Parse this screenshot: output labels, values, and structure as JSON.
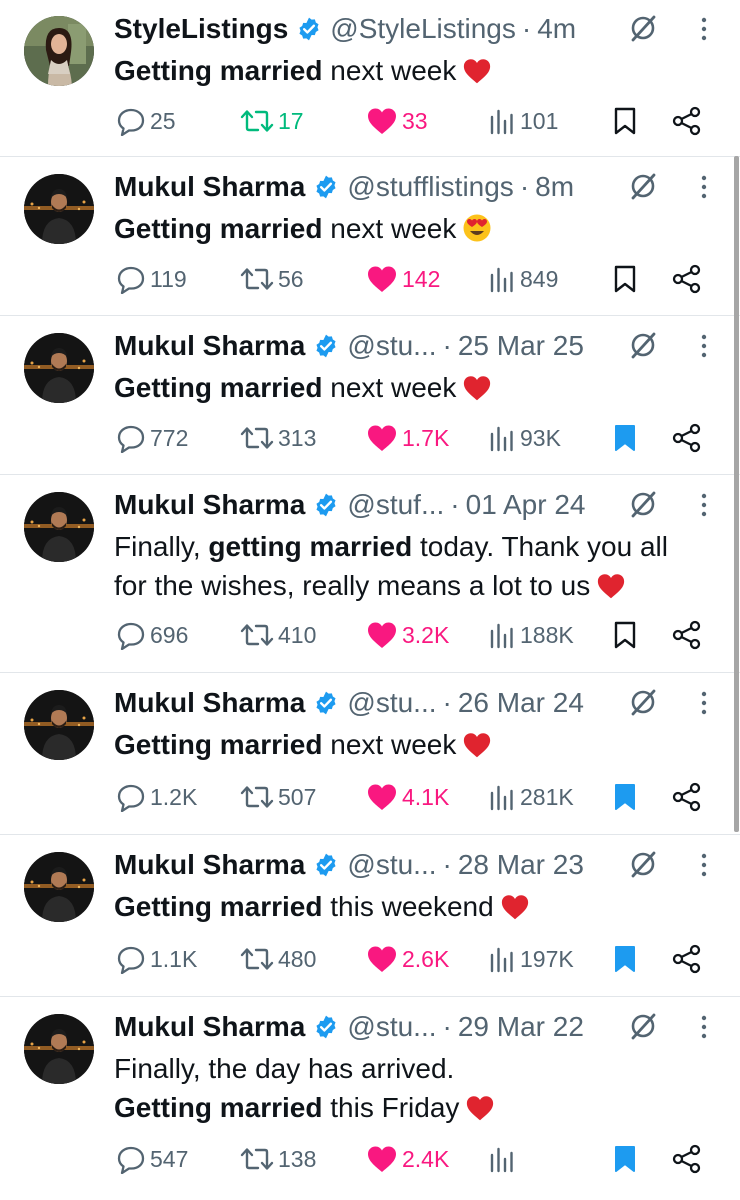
{
  "colors": {
    "accent": "#1d9bf0",
    "like": "#f91880",
    "retweet": "#00ba7c",
    "muted": "#536471",
    "verified": "#1d9bf0"
  },
  "tweets": [
    {
      "name": "StyleListings",
      "handle": "@StyleListings",
      "sep": "·",
      "time": "4m",
      "lines": [
        {
          "bold": "Getting married",
          "rest": " next week",
          "emoji": "heart-emoji"
        }
      ],
      "replies": "25",
      "retweets": "17",
      "likes": "33",
      "views": "101",
      "bookmarked": false,
      "liked": true,
      "retweeted": true,
      "avatar": "woman"
    },
    {
      "name": "Mukul Sharma",
      "handle": "@stufflistings",
      "sep": "·",
      "time": "8m",
      "lines": [
        {
          "bold": "Getting married",
          "rest": " next week",
          "emoji": "heart-eyes-emoji"
        }
      ],
      "replies": "119",
      "retweets": "56",
      "likes": "142",
      "views": "849",
      "bookmarked": false,
      "liked": true,
      "retweeted": false,
      "avatar": "man"
    },
    {
      "name": "Mukul Sharma",
      "handle": "@stu...",
      "sep": "·",
      "time": "25 Mar 25",
      "lines": [
        {
          "bold": "Getting married",
          "rest": " next week",
          "emoji": "heart-emoji"
        }
      ],
      "replies": "772",
      "retweets": "313",
      "likes": "1.7K",
      "views": "93K",
      "bookmarked": true,
      "liked": true,
      "retweeted": false,
      "avatar": "man"
    },
    {
      "name": "Mukul Sharma",
      "handle": "@stuf...",
      "sep": "·",
      "time": "01 Apr 24",
      "lines": [
        {
          "plain": "Finally, ",
          "bold": "getting married",
          "rest": " today. Thank you all"
        },
        {
          "rest": "for the wishes, really means a lot to us",
          "emoji": "heart-emoji"
        }
      ],
      "replies": "696",
      "retweets": "410",
      "likes": "3.2K",
      "views": "188K",
      "bookmarked": false,
      "liked": true,
      "retweeted": false,
      "avatar": "man"
    },
    {
      "name": "Mukul Sharma",
      "handle": "@stu...",
      "sep": "·",
      "time": "26 Mar 24",
      "lines": [
        {
          "bold": "Getting married",
          "rest": " next week",
          "emoji": "heart-emoji"
        }
      ],
      "replies": "1.2K",
      "retweets": "507",
      "likes": "4.1K",
      "views": "281K",
      "bookmarked": true,
      "liked": true,
      "retweeted": false,
      "avatar": "man"
    },
    {
      "name": "Mukul Sharma",
      "handle": "@stu...",
      "sep": "·",
      "time": "28 Mar 23",
      "lines": [
        {
          "bold": "Getting married",
          "rest": " this weekend",
          "emoji": "heart-emoji"
        }
      ],
      "replies": "1.1K",
      "retweets": "480",
      "likes": "2.6K",
      "views": "197K",
      "bookmarked": true,
      "liked": true,
      "retweeted": false,
      "avatar": "man"
    },
    {
      "name": "Mukul Sharma",
      "handle": "@stu...",
      "sep": "·",
      "time": "29 Mar 22",
      "lines": [
        {
          "rest": "Finally, the day has arrived."
        },
        {
          "bold": "Getting married",
          "rest": " this Friday",
          "emoji": "heart-emoji"
        }
      ],
      "replies": "547",
      "retweets": "138",
      "likes": "2.4K",
      "views": "",
      "bookmarked": true,
      "liked": true,
      "retweeted": false,
      "avatar": "man"
    }
  ]
}
